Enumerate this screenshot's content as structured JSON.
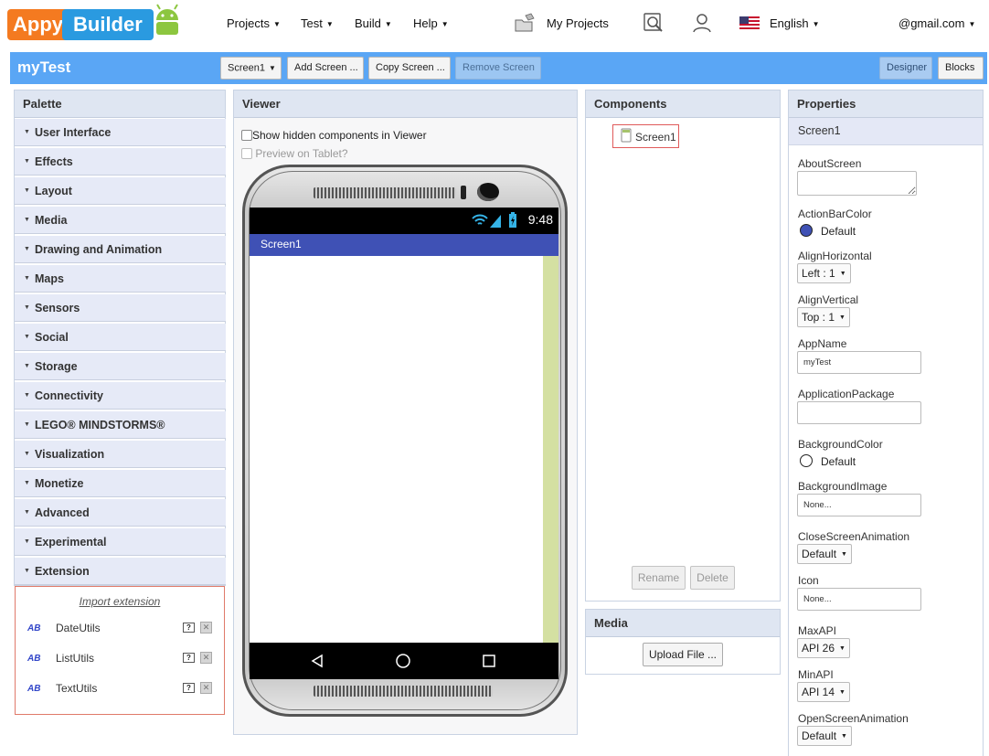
{
  "brand": {
    "appy": "Appy",
    "builder": "Builder"
  },
  "nav": {
    "projects": "Projects",
    "test": "Test",
    "build": "Build",
    "help": "Help",
    "my_projects": "My Projects",
    "language": "English",
    "account": "@gmail.com"
  },
  "toolbar": {
    "project_name": "myTest",
    "screen_select": "Screen1",
    "add_screen": "Add Screen ...",
    "copy_screen": "Copy Screen ...",
    "remove_screen": "Remove Screen",
    "designer": "Designer",
    "blocks": "Blocks"
  },
  "palette": {
    "title": "Palette",
    "categories": [
      "User Interface",
      "Effects",
      "Layout",
      "Media",
      "Drawing and Animation",
      "Maps",
      "Sensors",
      "Social",
      "Storage",
      "Connectivity",
      "LEGO® MINDSTORMS®",
      "Visualization",
      "Monetize",
      "Advanced",
      "Experimental",
      "Extension"
    ],
    "import_extension": "Import extension",
    "extensions": [
      {
        "name": "DateUtils",
        "logo": "AB"
      },
      {
        "name": "ListUtils",
        "logo": "AB"
      },
      {
        "name": "TextUtils",
        "logo": "AB"
      }
    ]
  },
  "viewer": {
    "title": "Viewer",
    "show_hidden": "Show hidden components in Viewer",
    "preview_tablet": "Preview on Tablet?",
    "phone_time": "9:48",
    "screen_title": "Screen1"
  },
  "components": {
    "title": "Components",
    "root": "Screen1",
    "rename": "Rename",
    "delete": "Delete"
  },
  "media": {
    "title": "Media",
    "upload": "Upload File ..."
  },
  "properties": {
    "title": "Properties",
    "component": "Screen1",
    "about_screen_label": "AboutScreen",
    "about_screen_value": "",
    "action_bar_color_label": "ActionBarColor",
    "action_bar_color_value": "Default",
    "action_bar_color_hex": "#3f51b5",
    "align_horizontal_label": "AlignHorizontal",
    "align_horizontal_value": "Left : 1",
    "align_vertical_label": "AlignVertical",
    "align_vertical_value": "Top : 1",
    "app_name_label": "AppName",
    "app_name_value": "myTest",
    "application_package_label": "ApplicationPackage",
    "application_package_value": "",
    "background_color_label": "BackgroundColor",
    "background_color_value": "Default",
    "background_color_hex": "#ffffff",
    "background_image_label": "BackgroundImage",
    "background_image_value": "None...",
    "close_screen_animation_label": "CloseScreenAnimation",
    "close_screen_animation_value": "Default",
    "icon_label": "Icon",
    "icon_value": "None...",
    "max_api_label": "MaxAPI",
    "max_api_value": "API 26",
    "min_api_label": "MinAPI",
    "min_api_value": "API 14",
    "open_screen_animation_label": "OpenScreenAnimation",
    "open_screen_animation_value": "Default"
  },
  "colors": {
    "toolbar_blue": "#5aa6f5",
    "screen_titlebar": "#3f51b5",
    "scroll_strip": "#d4e0a2",
    "logo_orange": "#f47a20",
    "logo_blue": "#2a9ae0"
  }
}
